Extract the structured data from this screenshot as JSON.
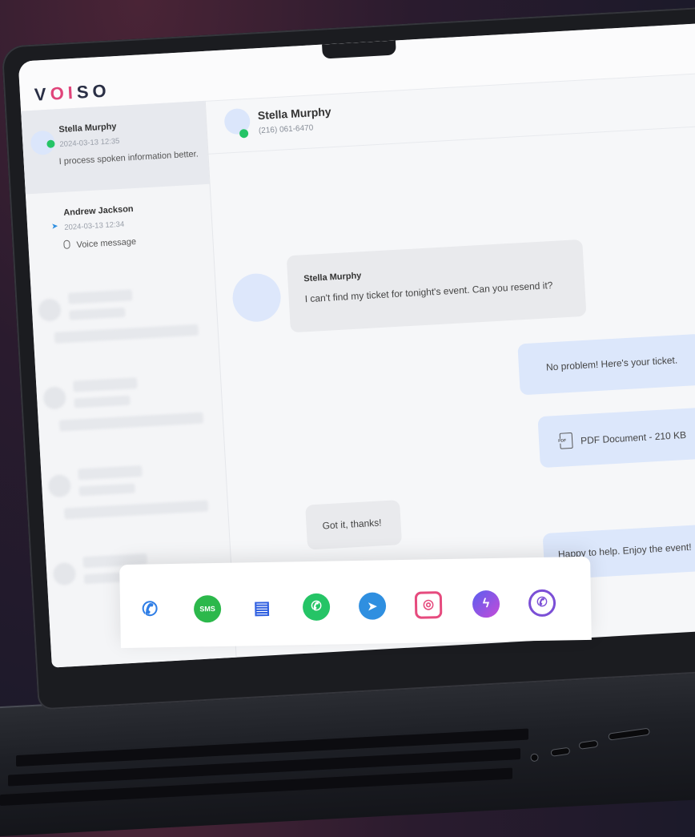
{
  "brand": {
    "logo": "VOISO",
    "logo_first": "V",
    "logo_accent": "OI",
    "logo_rest": "SO"
  },
  "sidebar": {
    "conversations": [
      {
        "name": "Stella Murphy",
        "date": "2024-03-13 12:35",
        "preview": "I process spoken information better.",
        "channel": "whatsapp"
      },
      {
        "name": "Andrew Jackson",
        "date": "2024-03-13 12:34",
        "preview": "Voice message",
        "channel": "telegram"
      }
    ]
  },
  "chat": {
    "contact_name": "Stella Murphy",
    "contact_phone": "(216) 061-6470",
    "messages": [
      {
        "direction": "in",
        "sender": "Stella Murphy",
        "text": "I can't find my ticket for tonight's event. Can you resend it?"
      },
      {
        "direction": "out",
        "text": "No problem! Here's your ticket."
      },
      {
        "direction": "out",
        "attachment": "PDF Document - 210 KB"
      },
      {
        "direction": "in",
        "text": "Got it, thanks!"
      },
      {
        "direction": "out",
        "text": "Happy to help. Enjoy the event!"
      }
    ]
  },
  "channels": {
    "icons": [
      "phone-icon",
      "sms-icon",
      "chat-icon",
      "whatsapp-icon",
      "telegram-icon",
      "instagram-icon",
      "messenger-icon",
      "viber-icon"
    ],
    "sms_label": "SMS"
  },
  "colors": {
    "accent": "#2f7ee6",
    "whatsapp": "#25c466",
    "incoming_bubble": "#e9eaed",
    "outgoing_bubble": "#dce7fb"
  }
}
